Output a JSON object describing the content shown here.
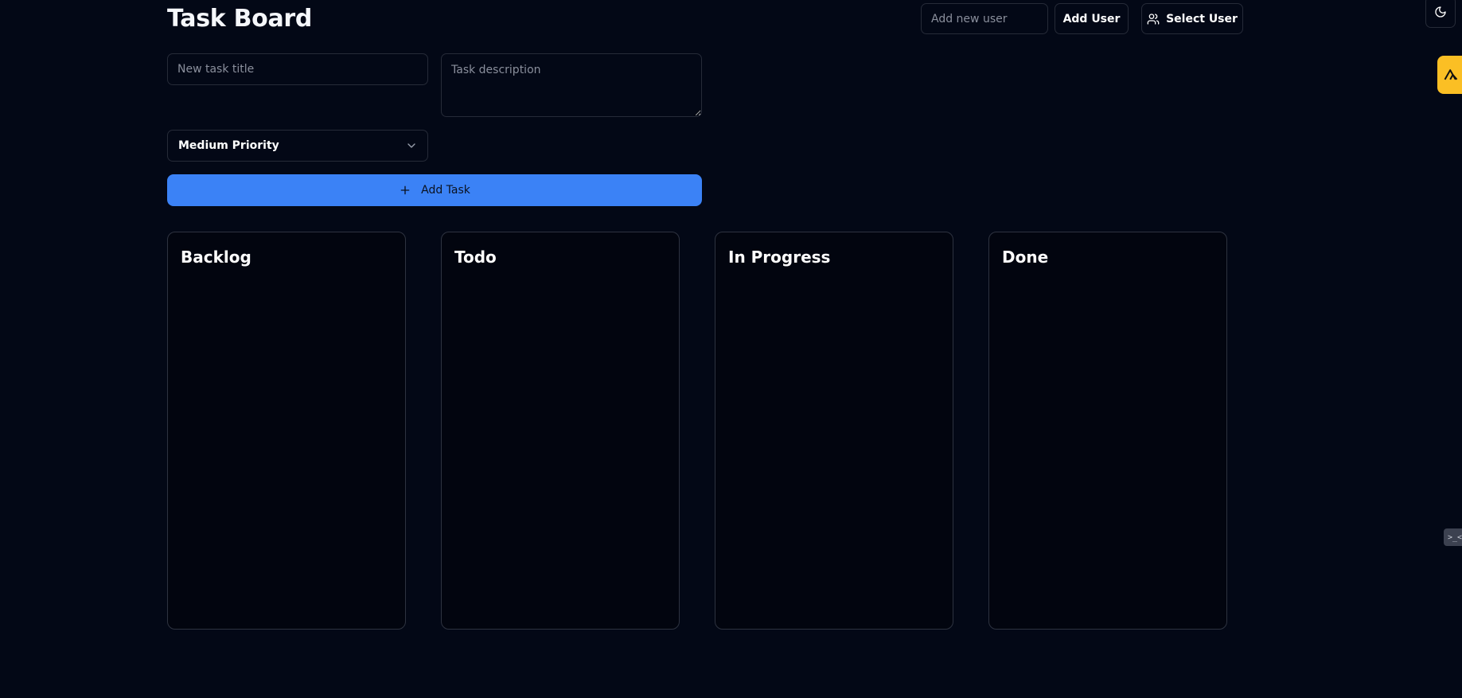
{
  "header": {
    "title": "Task Board",
    "new_user_placeholder": "Add new user",
    "add_user_label": "Add User",
    "select_user_label": "Select User",
    "theme_icon": "moon-icon"
  },
  "task_form": {
    "title_placeholder": "New task title",
    "description_placeholder": "Task description",
    "priority_selected": "Medium Priority",
    "add_task_label": "Add Task"
  },
  "columns": [
    {
      "title": "Backlog"
    },
    {
      "title": "Todo"
    },
    {
      "title": "In Progress"
    },
    {
      "title": "Done"
    }
  ],
  "overlay": {
    "side_tab_text": ">_<"
  },
  "colors": {
    "background": "#030816",
    "accent": "#3b82f6",
    "widget": "#fbbf24",
    "border": "#262b38"
  }
}
